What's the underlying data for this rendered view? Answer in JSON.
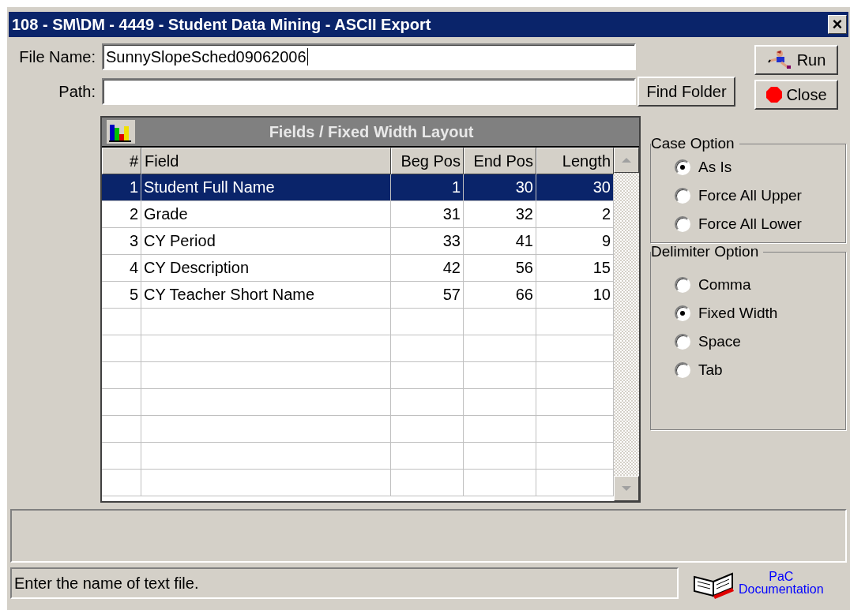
{
  "window": {
    "title": "108 - SM\\DM - 4449 - Student Data Mining - ASCII Export",
    "close_glyph": "×"
  },
  "file_name": {
    "label": "File Name:",
    "value": "SunnySlopeSched09062006"
  },
  "path": {
    "label": "Path:"
  },
  "buttons": {
    "find_folder": "Find Folder",
    "run": "Run",
    "close": "Close"
  },
  "table": {
    "title": "Fields / Fixed Width Layout",
    "columns": [
      "#",
      "Field",
      "Beg Pos",
      "End Pos",
      "Length"
    ],
    "rows": [
      {
        "cells": [
          "1",
          "Student Full Name",
          "1",
          "30",
          "30"
        ],
        "selected": true
      },
      {
        "cells": [
          "2",
          "Grade",
          "31",
          "32",
          "2"
        ],
        "selected": false
      },
      {
        "cells": [
          "3",
          "CY Period",
          "33",
          "41",
          "9"
        ],
        "selected": false
      },
      {
        "cells": [
          "4",
          "CY Description",
          "42",
          "56",
          "15"
        ],
        "selected": false
      },
      {
        "cells": [
          "5",
          "CY Teacher Short Name",
          "57",
          "66",
          "10"
        ],
        "selected": false
      }
    ]
  },
  "case_option": {
    "title": "Case Option",
    "options": [
      {
        "label": "As Is",
        "selected": true
      },
      {
        "label": "Force All Upper",
        "selected": false
      },
      {
        "label": "Force All Lower",
        "selected": false
      }
    ]
  },
  "delimiter_option": {
    "title": "Delimiter Option",
    "options": [
      {
        "label": "Comma",
        "selected": false
      },
      {
        "label": "Fixed Width",
        "selected": true
      },
      {
        "label": "Space",
        "selected": false
      },
      {
        "label": "Tab",
        "selected": false
      }
    ]
  },
  "status_bar": {
    "message": "Enter the name of text file.",
    "help_line1": "PaC",
    "help_line2": "Documentation"
  }
}
